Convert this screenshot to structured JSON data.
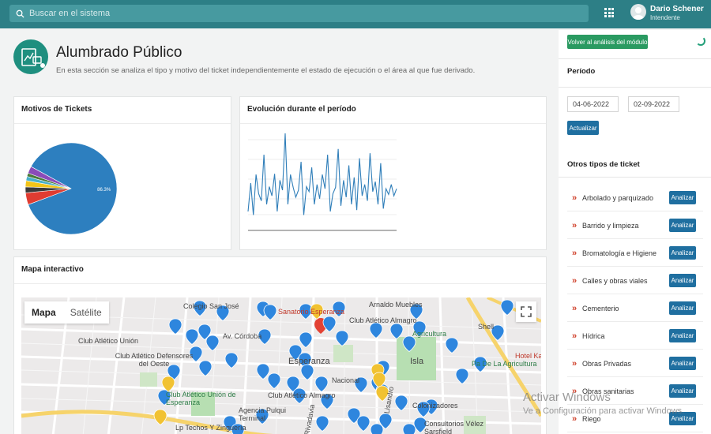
{
  "topbar": {
    "search_placeholder": "Buscar en el sistema",
    "user_name": "Dario Schener",
    "user_role": "Intendente"
  },
  "header": {
    "title": "Alumbrado Público",
    "description": "En esta sección se analiza el tipo y motivo del ticket independientemente el estado de ejecución o el área al que fue derivado."
  },
  "cards": {
    "motivos": "Motivos de Tickets",
    "evolucion": "Evolución durante el período",
    "mapa": "Mapa interactivo"
  },
  "chart_data": [
    {
      "type": "pie",
      "title": "Motivos de Tickets",
      "slices": [
        {
          "value": 86.3,
          "color": "#2d7fbf",
          "label": "86.3%"
        },
        {
          "value": 4.2,
          "color": "#e03c31"
        },
        {
          "value": 2.1,
          "color": "#3a3a3a"
        },
        {
          "value": 2.2,
          "color": "#f2c419"
        },
        {
          "value": 1.5,
          "color": "#48b0c9"
        },
        {
          "value": 1.2,
          "color": "#4a7a3a"
        },
        {
          "value": 2.5,
          "color": "#8a4bb8"
        }
      ]
    },
    {
      "type": "line",
      "title": "Evolución durante el período",
      "color": "#2f7eb9",
      "ylim": [
        0,
        130
      ],
      "values": [
        20,
        60,
        15,
        72,
        45,
        35,
        100,
        30,
        55,
        42,
        73,
        20,
        64,
        50,
        130,
        30,
        72,
        54,
        40,
        50,
        90,
        15,
        55,
        48,
        82,
        30,
        58,
        38,
        72,
        52,
        100,
        20,
        45,
        54,
        108,
        28,
        64,
        40,
        85,
        30,
        68,
        22,
        95,
        42,
        58,
        35,
        102,
        48,
        62,
        30,
        88,
        24,
        52,
        44,
        58,
        42,
        52
      ]
    }
  ],
  "map": {
    "tabs": [
      {
        "label": "Mapa",
        "active": true
      },
      {
        "label": "Satélite",
        "active": false
      }
    ],
    "places": [
      {
        "text": "Colegio San José",
        "color": "#444"
      },
      {
        "text": "Sanatorio Esperanza",
        "color": "#c0392b"
      },
      {
        "text": "Arnaldo Muebles",
        "color": "#444"
      },
      {
        "text": "Av. Córdoba",
        "color": "#444"
      },
      {
        "text": "Club Atlético Almagro",
        "color": "#444"
      },
      {
        "text": "Club Atlético Defensores del Oeste",
        "color": "#444"
      },
      {
        "text": "Esperanza",
        "color": "#222"
      },
      {
        "text": "Isla",
        "color": "#222"
      },
      {
        "text": "Pa De La Agricultura",
        "color": "#444"
      },
      {
        "text": "Hotel Ka",
        "color": "#c0392b"
      },
      {
        "text": "Shell",
        "color": "#444"
      },
      {
        "text": "Club Atlético Unión de Esperanza",
        "color": "#2e7d47"
      },
      {
        "text": "Club Atlético Almagro",
        "color": "#444"
      },
      {
        "text": "Agencia Pulqui Terminal",
        "color": "#444"
      },
      {
        "text": "Lp Techos Y Zinguería",
        "color": "#444"
      },
      {
        "text": "Consultorios Vélez Sarsfield",
        "color": "#444"
      },
      {
        "text": "Agricultura",
        "color": "#2e7d47"
      },
      {
        "text": "Colonizadores",
        "color": "#444"
      },
      {
        "text": "Rivadavia",
        "color": "#444"
      },
      {
        "text": "Lisandro",
        "color": "#444"
      },
      {
        "text": "Nacional",
        "color": "#444"
      },
      {
        "text": "Club Atlético Unión",
        "color": "#444"
      }
    ]
  },
  "sidebar": {
    "back_button": "Volver al análisis del módulo",
    "periodo_label": "Período",
    "date_from": "04-06-2022",
    "date_to": "02-09-2022",
    "update_button": "Actualizar",
    "otros_label": "Otros tipos de ticket",
    "analyze_label": "Analizar",
    "tickets": [
      "Arbolado y parquizado",
      "Barrido y limpieza",
      "Bromatología e Higiene",
      "Calles y obras viales",
      "Cementerio",
      "Hídrica",
      "Obras Privadas",
      "Obras sanitarias",
      "Riego"
    ]
  },
  "watermark": {
    "line1": "Activar Windows",
    "line2": "Ve a Configuración para activar Windows."
  }
}
